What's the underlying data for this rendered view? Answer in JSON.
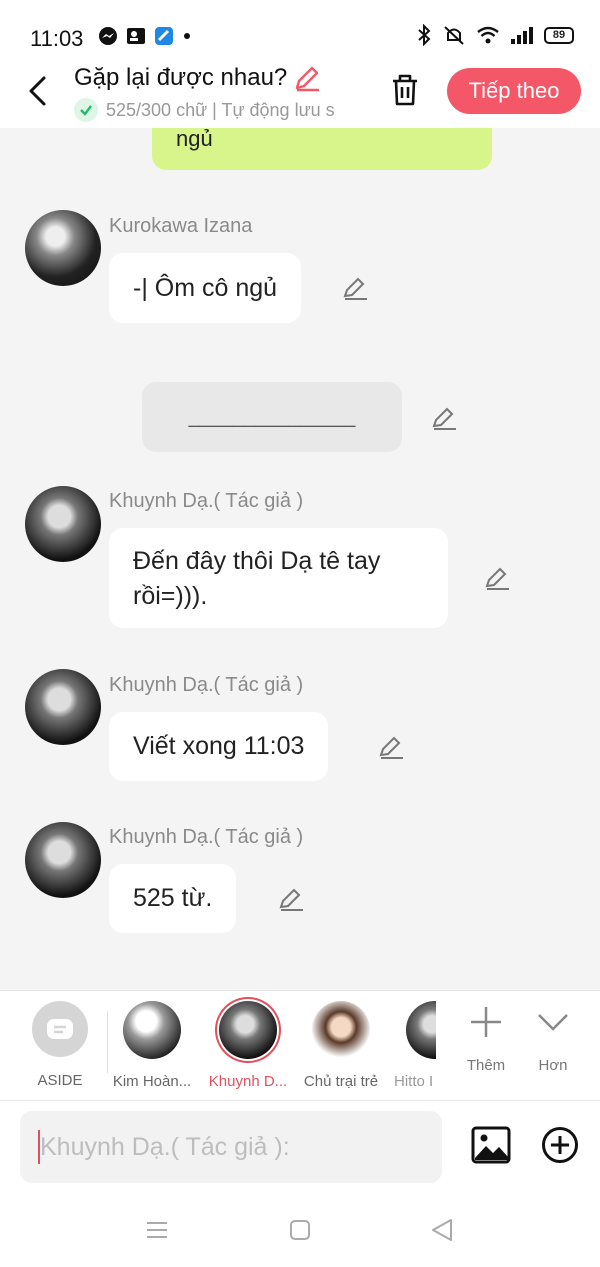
{
  "status_bar": {
    "time": "11:03",
    "battery": "89"
  },
  "header": {
    "title": "Gặp lại được nhau?",
    "subtitle": "525/300 chữ | Tự động lưu s",
    "next_label": "Tiếp theo"
  },
  "chat": {
    "partial_bubble_text": "ngủ",
    "messages": [
      {
        "name": "Kurokawa Izana",
        "text": "-| Ôm cô ngủ"
      },
      {
        "divider": "_______________"
      },
      {
        "name": "Khuynh Dạ.( Tác giả )",
        "text_line1": "Đến đây thôi Dạ tê tay",
        "text_line2": "rồi=)))."
      },
      {
        "name": "Khuynh Dạ.( Tác giả )",
        "text": "Viết xong 11:03"
      },
      {
        "name": "Khuynh Dạ.( Tác giả )",
        "text": "525 từ."
      }
    ]
  },
  "characters": [
    {
      "label": "ASIDE"
    },
    {
      "label": "Kim Hoàn..."
    },
    {
      "label": "Khuynh D..."
    },
    {
      "label": "Chủ trại trẻ"
    },
    {
      "label": "Hitto I"
    }
  ],
  "tools": {
    "more_label": "Thêm",
    "collapse_label": "Hơn"
  },
  "input": {
    "placeholder": "Khuynh Dạ.( Tác giả ):"
  },
  "colors": {
    "accent": "#f45868",
    "green_bubble": "#d8f58c",
    "background": "#f4f4f4"
  }
}
